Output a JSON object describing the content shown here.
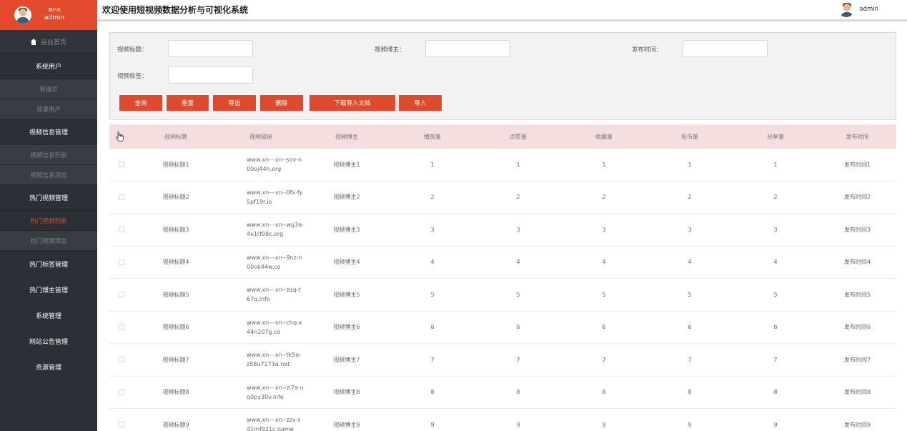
{
  "sidebar": {
    "user_label": "用户名",
    "user_name": "admin",
    "home": "后台首页",
    "items": [
      {
        "label": "系统用户",
        "type": "group"
      },
      {
        "label": "管理员",
        "type": "sub"
      },
      {
        "label": "登录用户",
        "type": "sub"
      },
      {
        "label": "视频信息管理",
        "type": "group"
      },
      {
        "label": "视频信息列表",
        "type": "sub"
      },
      {
        "label": "视频信息添加",
        "type": "sub"
      },
      {
        "label": "热门视频管理",
        "type": "group"
      },
      {
        "label": "热门视频列表",
        "type": "sub-active"
      },
      {
        "label": "热门视频添加",
        "type": "sub"
      },
      {
        "label": "热门标签管理",
        "type": "plain"
      },
      {
        "label": "热门博主管理",
        "type": "plain"
      },
      {
        "label": "系统管理",
        "type": "plain"
      },
      {
        "label": "网站公告管理",
        "type": "plain"
      },
      {
        "label": "资源管理",
        "type": "plain"
      }
    ]
  },
  "header": {
    "title": "欢迎使用短视频数据分析与可视化系统",
    "user_name": "admin"
  },
  "search": {
    "title_label": "视频标题：",
    "blogger_label": "视频博主：",
    "time_label": "发布时间：",
    "tag_label": "视频标签：",
    "buttons": {
      "query": "查询",
      "reset": "重置",
      "export": "导出",
      "delete": "删除",
      "download_template": "下载导入文档",
      "import": "导入"
    }
  },
  "table": {
    "headers": [
      "视频标题",
      "视频链接",
      "视频博主",
      "播放量",
      "点赞量",
      "收藏量",
      "投币量",
      "分享量",
      "发布时间"
    ],
    "rows": [
      [
        "视频标题1",
        "www.xn---xn--sov-n00oj44h.org",
        "视频博主1",
        "1",
        "1",
        "1",
        "1",
        "1",
        "发布时间1"
      ],
      [
        "视频标题2",
        "www.xn---xn--0fx-fy5pf19r.io",
        "视频博主2",
        "2",
        "2",
        "2",
        "2",
        "2",
        "发布时间2"
      ],
      [
        "视频标题3",
        "www.xn---xn--wg3a-4x1rf08c.org",
        "视频博主3",
        "3",
        "3",
        "3",
        "3",
        "3",
        "发布时间3"
      ],
      [
        "视频标题4",
        "www.xn---xn--9nz-n00ok44w.co",
        "视频博主4",
        "4",
        "4",
        "4",
        "4",
        "4",
        "发布时间4"
      ],
      [
        "视频标题5",
        "www.xn---xn--zqq-t67q.info",
        "视频博主5",
        "5",
        "5",
        "5",
        "5",
        "5",
        "发布时间5"
      ],
      [
        "视频标题6",
        "www.xn---xn--chq-x44n207g.co",
        "视频博主6",
        "6",
        "6",
        "6",
        "6",
        "6",
        "发布时间6"
      ],
      [
        "视频标题7",
        "www.xn---xn--tk5a-z58u7173a.net",
        "视频博主7",
        "7",
        "7",
        "7",
        "7",
        "7",
        "发布时间7"
      ],
      [
        "视频标题8",
        "www.xn---xn--zi7a-uq0py30v.info",
        "视频博主8",
        "8",
        "8",
        "8",
        "8",
        "8",
        "发布时间8"
      ],
      [
        "视频标题9",
        "www.xn---xn--zzv-s41mf921c.name",
        "视频博主9",
        "9",
        "9",
        "9",
        "9",
        "9",
        "发布时间9"
      ]
    ]
  },
  "colors": {
    "accent": "#e34a2b",
    "sidebar_bg": "#2b2f36",
    "table_header_bg": "#f4dede"
  }
}
